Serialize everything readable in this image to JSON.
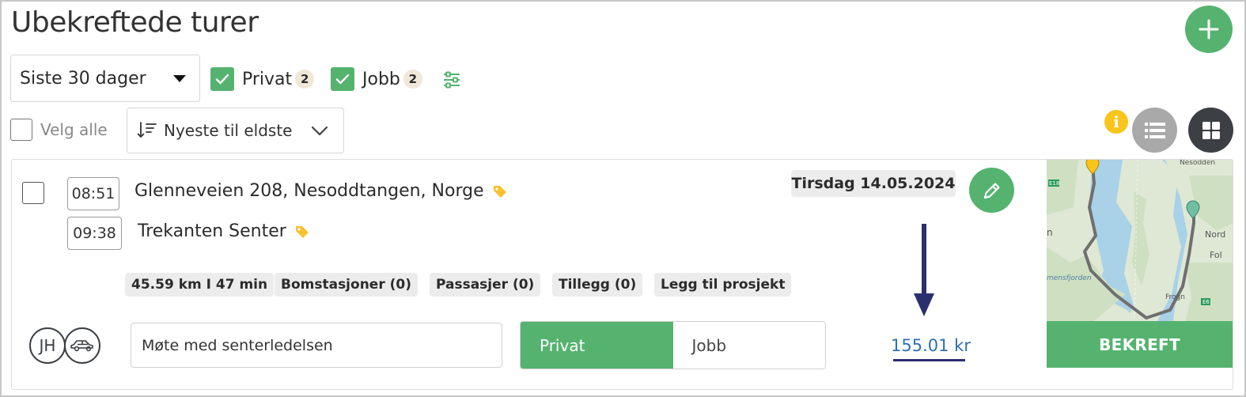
{
  "header": {
    "title": "Ubekreftede turer",
    "add_label": "+"
  },
  "filters": {
    "period": "Siste 30 dager",
    "privat": {
      "label": "Privat",
      "count": "2",
      "checked": true
    },
    "jobb": {
      "label": "Jobb",
      "count": "2",
      "checked": true
    }
  },
  "toolbar": {
    "select_all": "Velg alle",
    "sort_label": "Nyeste til eldste",
    "info_glyph": "i"
  },
  "trip": {
    "start_time": "08:51",
    "start_address": "Glenneveien 208, Nesoddtangen, Norge",
    "end_time": "09:38",
    "end_address": "Trekanten Senter",
    "date": "Tirsdag 14.05.2024",
    "chips": {
      "distance": "45.59 km I 47 min",
      "tolls": "Bomstasjoner (0)",
      "passengers": "Passasjer (0)",
      "extras": "Tillegg (0)",
      "project": "Legg til prosjekt"
    },
    "driver_initials": "JH",
    "note": "Møte med senterledelsen",
    "type_options": {
      "privat": "Privat",
      "jobb": "Jobb",
      "selected": "Privat"
    },
    "amount": "155.01 kr",
    "confirm_label": "BEKREFT",
    "map": {
      "labels": {
        "top": "Nesodden",
        "e18": "E18",
        "left": "n",
        "fjord": "mensfjorden",
        "right1": "Nord",
        "right2": "Fol",
        "frogn": "Frogn",
        "e6": "E6"
      }
    }
  },
  "colors": {
    "accent_green": "#55b36f",
    "link_blue": "#2f6fb5",
    "info_yellow": "#f7c51b",
    "annotation_arrow": "#2a2f6e"
  }
}
